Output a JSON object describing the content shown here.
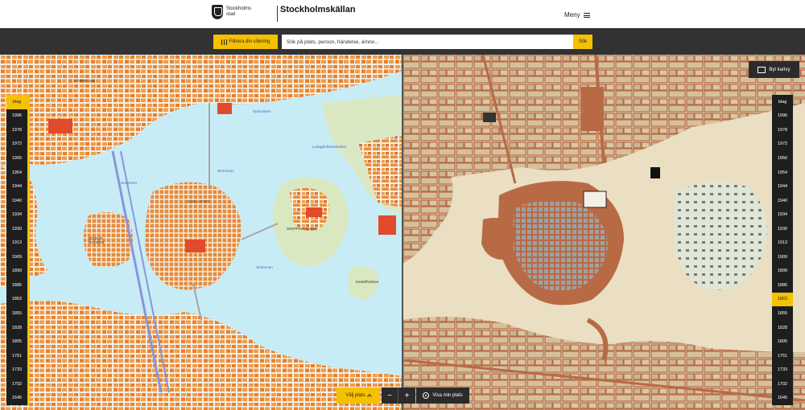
{
  "header": {
    "logo_line1": "Stockholms",
    "logo_line2": "stad",
    "site_title": "Stockholmskällan",
    "menu_label": "Meny"
  },
  "search": {
    "filter_label": "Filtrera din sökning",
    "placeholder": "Sök på plats, person, händelse, ämne...",
    "button_label": "Sök"
  },
  "map_view_button": "Byt kartvy",
  "map_labels": {
    "norrmalm": "NORRMALM",
    "gamla_stan": "GAMLA STAN",
    "riddarholmen": "RIDDAR-HOLMEN",
    "skeppsholmen": "SKEPPSHOLMEN",
    "kastellholmen": "Kastellholmen",
    "strommen": "Strömmen",
    "nybroviken": "Nybroviken",
    "ladugardslandet": "Ladugårdslandsviken",
    "norrstrom": "Norrström",
    "strommen2": "Strömmen"
  },
  "years": [
    "Idag",
    "1996",
    "1978",
    "1972",
    "1956",
    "1954",
    "1944",
    "1940",
    "1934",
    "1930",
    "1913",
    "1909",
    "1899",
    "1885",
    "1863",
    "1855",
    "1828",
    "1805",
    "1751",
    "1733",
    "1702",
    "1645"
  ],
  "left_active_year": "Idag",
  "right_active_year": "1863",
  "controls": {
    "choose_place": "Välj plats",
    "zoom_out": "−",
    "zoom_in": "+",
    "show_location": "Visa min plats"
  },
  "colors": {
    "accent": "#f5c100",
    "dark": "#323232",
    "water_modern": "#c8ecf6",
    "buildings_modern": "#e8a050",
    "water_historic": "#e6dcc4",
    "buildings_historic": "#b86a45"
  }
}
